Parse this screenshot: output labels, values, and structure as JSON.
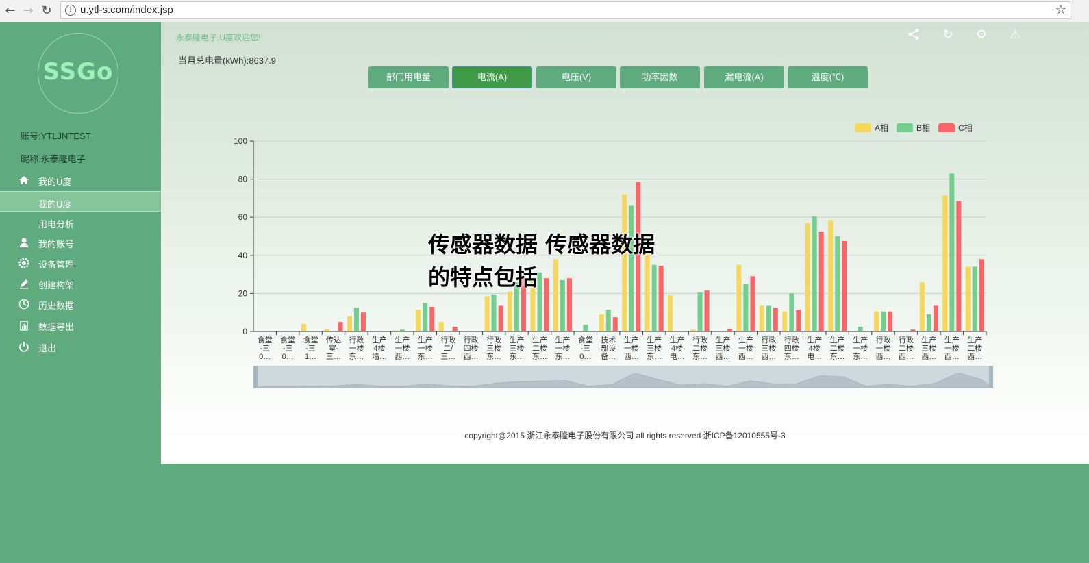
{
  "browser": {
    "url": "u.ytl-s.com/index.jsp",
    "back_icon": "back-arrow-icon",
    "forward_icon": "forward-arrow-icon",
    "reload_icon": "reload-icon",
    "bookmark_icon": "star-icon"
  },
  "sidebar": {
    "logo": "SSGo",
    "account": "账号:YTLJNTEST",
    "nickname": "昵称:永泰隆电子",
    "items": [
      {
        "label": "我的U度",
        "icon": "home-icon"
      },
      {
        "label": "我的U度",
        "icon": ""
      },
      {
        "label": "用电分析",
        "icon": ""
      },
      {
        "label": "我的账号",
        "icon": "user-icon"
      },
      {
        "label": "设备管理",
        "icon": "gear-icon"
      },
      {
        "label": "创建构架",
        "icon": "edit-icon"
      },
      {
        "label": "历史数据",
        "icon": "clock-icon"
      },
      {
        "label": "数据导出",
        "icon": "export-icon"
      },
      {
        "label": "退出",
        "icon": "power-icon"
      }
    ]
  },
  "header": {
    "welcome": "永泰隆电子,U度欢迎您!",
    "total_power": "当月总电量(kWh):8637.9",
    "icons": [
      "share-icon",
      "refresh-icon",
      "settings-icon",
      "warning-icon"
    ]
  },
  "tabs": [
    {
      "label": "部门用电量"
    },
    {
      "label": "电流(A)"
    },
    {
      "label": "电压(V)"
    },
    {
      "label": "功率因数"
    },
    {
      "label": "漏电流(A)"
    },
    {
      "label": "温度(℃)"
    }
  ],
  "active_tab": "电流(A)",
  "overlay_title": "传感器数据 传感器数据的特点包括",
  "footer": "copyright@2015 浙江永泰隆电子股份有限公司 all rights reserved 浙ICP备12010555号-3",
  "colors": {
    "a": "#f5d75c",
    "b": "#74cf8f",
    "c": "#fa6567",
    "sidebar": "#5fab7d"
  },
  "chart_data": {
    "type": "bar",
    "categories": [
      "食堂-三0…",
      "食堂-三0…",
      "食堂-三1…",
      "传达室-三…",
      "行政一楼东…",
      "生产4楼墙…",
      "生产一楼西…",
      "生产一楼东…",
      "行政二/三…",
      "行政四楼西…",
      "行政三楼东…",
      "生产三楼东…",
      "生产二楼东…",
      "生产一楼东…",
      "食堂-三0…",
      "技术部设备…",
      "生产一楼西…",
      "生产三楼东…",
      "生产4楼电…",
      "行政二楼东…",
      "生产三楼西…",
      "生产一楼西…",
      "行政三楼西…",
      "行政四楼东…",
      "生产4楼电…",
      "生产二楼东…",
      "生产一楼东…",
      "行政一楼西…",
      "行政二楼西…",
      "生产三楼西…",
      "生产一楼西…",
      "生产二楼西…"
    ],
    "series": [
      {
        "name": "A相",
        "values": [
          0,
          0,
          4,
          1.5,
          8,
          0,
          0.5,
          11.5,
          5,
          0,
          18.5,
          21,
          28,
          38,
          0,
          9,
          72,
          42,
          19,
          1,
          0,
          35,
          13.5,
          10.5,
          57,
          58.5,
          0,
          10.5,
          0,
          26,
          71.5,
          34
        ]
      },
      {
        "name": "B相",
        "values": [
          0,
          0,
          0,
          0,
          12.5,
          0,
          1,
          15,
          0,
          0,
          19.5,
          26,
          31,
          27,
          3.5,
          11.5,
          66,
          35,
          0,
          20.5,
          0,
          25,
          13.5,
          20,
          60.5,
          50,
          2.5,
          10.5,
          0,
          9,
          83,
          34
        ]
      },
      {
        "name": "C相",
        "values": [
          0,
          0,
          0,
          5,
          10,
          0,
          0,
          13,
          2.5,
          0,
          13.5,
          28,
          28,
          28,
          0,
          7.5,
          78.5,
          34.5,
          0,
          21.5,
          1.5,
          29,
          12.5,
          11.5,
          52.5,
          47.5,
          0,
          10.5,
          1,
          13.5,
          68.5,
          38
        ]
      }
    ],
    "ylim": [
      0,
      100
    ],
    "yticks": [
      0,
      20,
      40,
      60,
      80,
      100
    ],
    "legend": "top-right",
    "grid": true
  }
}
